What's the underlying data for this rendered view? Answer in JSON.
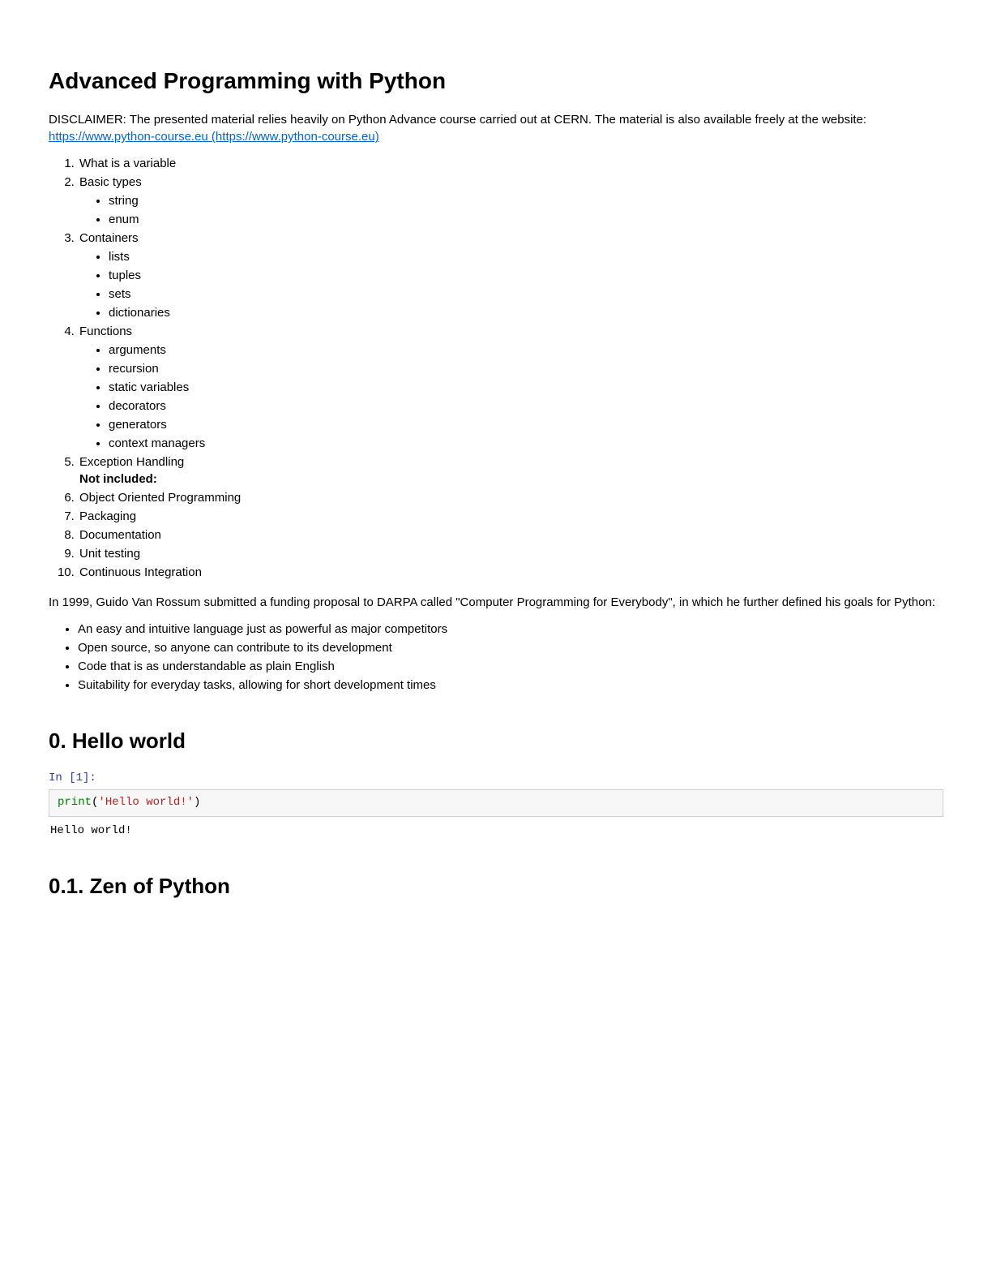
{
  "title": "Advanced Programming with Python",
  "disclaimer": {
    "prefix": "DISCLAIMER: The presented material relies heavily on Python Advance course carried out at CERN. The material is also available freely at the website: ",
    "link_text": "https://www.python-course.eu (https://www.python-course.eu)"
  },
  "toc": [
    {
      "label": "What is a variable",
      "sub": []
    },
    {
      "label": "Basic types",
      "sub": [
        "string",
        "enum"
      ]
    },
    {
      "label": "Containers",
      "sub": [
        "lists",
        "tuples",
        "sets",
        "dictionaries"
      ]
    },
    {
      "label": "Functions",
      "sub": [
        "arguments",
        "recursion",
        "static variables",
        "decorators",
        "generators",
        "context managers"
      ]
    },
    {
      "label": "Exception Handling",
      "sub": [],
      "after_note": "Not included:"
    },
    {
      "label": "Object Oriented Programming",
      "sub": []
    },
    {
      "label": "Packaging",
      "sub": []
    },
    {
      "label": "Documentation",
      "sub": []
    },
    {
      "label": "Unit testing",
      "sub": []
    },
    {
      "label": "Continuous Integration",
      "sub": []
    }
  ],
  "history_para": "In 1999, Guido Van Rossum submitted a funding proposal to DARPA called \"Computer Programming for Everybody\", in which he further defined his goals for Python:",
  "goals": [
    "An easy and intuitive language just as powerful as major competitors",
    "Open source, so anyone can contribute to its development",
    "Code that is as understandable as plain English",
    "Suitability for everyday tasks, allowing for short development times"
  ],
  "section0_title": "0. Hello world",
  "cell1": {
    "prompt": "In [1]:",
    "code_fn": "print",
    "code_open": "(",
    "code_str": "'Hello world!'",
    "code_close": ")",
    "output": "Hello world!"
  },
  "section01_title": "0.1. Zen of Python"
}
